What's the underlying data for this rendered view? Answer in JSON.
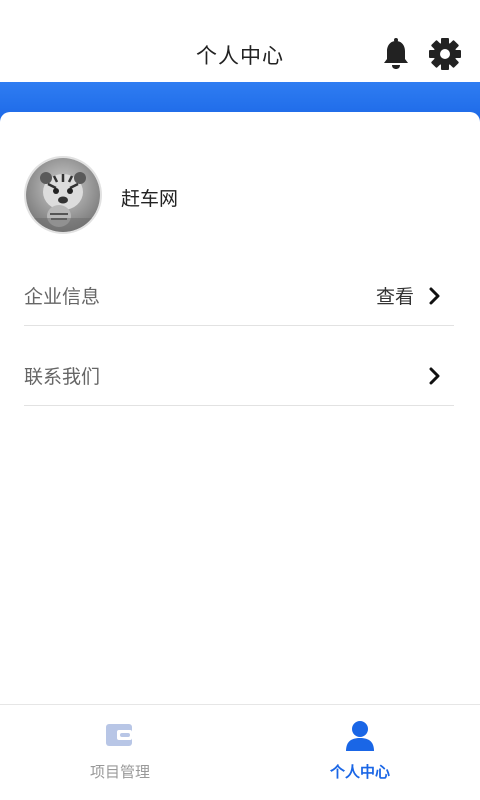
{
  "header": {
    "title": "个人中心",
    "bell_icon": "bell-icon",
    "settings_icon": "gear-icon"
  },
  "profile": {
    "name": "赶车网",
    "avatar_icon": "tiger-cub-avatar"
  },
  "menu": {
    "items": [
      {
        "label": "企业信息",
        "value": "查看",
        "icon": "chevron-right-icon"
      },
      {
        "label": "联系我们",
        "value": "",
        "icon": "chevron-right-icon"
      }
    ]
  },
  "bottom_nav": {
    "items": [
      {
        "label": "项目管理",
        "icon": "wallet-icon",
        "active": false
      },
      {
        "label": "个人中心",
        "icon": "user-icon",
        "active": true
      }
    ]
  },
  "colors": {
    "accent": "#1a66e6",
    "band": "#2f7df2",
    "inactive": "#999999",
    "inactive_icon": "#b8c6e6"
  }
}
